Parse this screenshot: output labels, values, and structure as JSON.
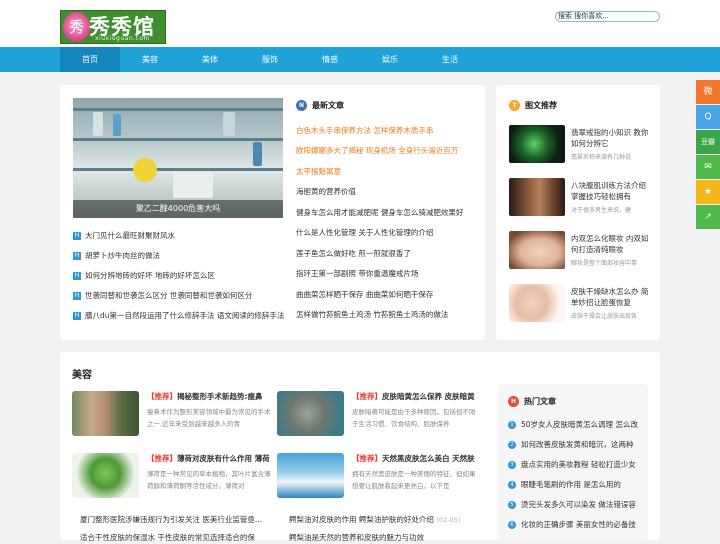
{
  "header": {
    "logo_text": "秀秀馆",
    "logo_glyph": "秀",
    "logo_sub": "xiuxiuguan.com",
    "search_label": "搜索",
    "search_placeholder": "搜索 搜你喜欢..."
  },
  "nav": [
    {
      "label": "首页",
      "active": true
    },
    {
      "label": "美容"
    },
    {
      "label": "美体"
    },
    {
      "label": "服饰"
    },
    {
      "label": "情感"
    },
    {
      "label": "娱乐"
    },
    {
      "label": "生活"
    }
  ],
  "slider": {
    "caption": "聚乙二醇4000危害大吗"
  },
  "featured_list": [
    "大门见什么最旺财聚财风水",
    "胡萝卜炒牛肉丝的做法",
    "如何分辨地砖的好坏 地砖的好坏怎么区",
    "世袭同替和世袭怎么区分 世袭同替和世袭如何区分",
    "膳八du第一自然段运用了什么修辞手法 语文阅读的修辞手法"
  ],
  "latest": {
    "icon": "N",
    "title": "最新文章",
    "items": [
      {
        "text": "白色木头手串保养方法 怎样保养木质手串",
        "hl": true
      },
      {
        "text": "欧阳娜娜多大了揭秘 现身机场 全身行头逼近百万",
        "hl": true
      },
      {
        "text": "太平猴魁寓意",
        "hl": true
      },
      {
        "text": "海胆黄的营养价值",
        "hl": false
      },
      {
        "text": "健身车怎么用才能减肥呢 健身车怎么骑减肥效果好",
        "hl": false
      },
      {
        "text": "什么是人性化管理 关于人性化管理的介绍",
        "hl": false
      },
      {
        "text": "莲子鱼怎么做好吃 煎一煎就很香了",
        "hl": false
      },
      {
        "text": "指环王第一部剧照 带你重温魔戒片场",
        "hl": false
      },
      {
        "text": "曲曲菜怎样晒干保存 曲曲菜如何晒干保存",
        "hl": false
      },
      {
        "text": "怎样做竹荪鲩鱼土鸡汤 竹荪鲩鱼土鸡汤的做法",
        "hl": false
      }
    ]
  },
  "picture_rec": {
    "icon": "T",
    "title": "图文推荐",
    "items": [
      {
        "title": "翡翠戒指的小知识 教你如何分辨它",
        "desc": "翡翠名称来源有几种说"
      },
      {
        "title": "八块腹肌训练方法介绍 掌握技巧轻松拥有",
        "desc": "对于很多男生来说，健"
      },
      {
        "title": "内双怎么化眼妆 内双如何打造清纯眼妆",
        "desc": "眼妆是整个面部妆容中靠"
      },
      {
        "title": "皮肤干燥缺水怎么办 简单妙招让脸蛋恢复",
        "desc": "皮肤干燥会让皮肤出现各"
      }
    ]
  },
  "beauty": {
    "title": "美容",
    "articles": [
      {
        "tag": "【推荐】",
        "title": "揭秘整形手术新趋势:瘦鼻",
        "desc": "瘦鼻术作为整形美容领域中最为常见的手术之一,近年来受到越来越多人的青"
      },
      {
        "tag": "【推荐】",
        "title": "皮肤暗黄怎么保养 皮肤暗黄",
        "desc": "皮肤暗黄可能是由于多种原因，包括但不限于生活习惯、饮食结构、肌肤保养"
      },
      {
        "tag": "【推荐】",
        "title": "薄荷对皮肤有什么作用 薄荷",
        "desc": "薄荷是一种常见的草本植物，其叶片富含薄荷醇和薄荷酮等活性成分。薄荷对"
      },
      {
        "tag": "【推荐】",
        "title": "天然黑皮肤怎么美白 天然肤",
        "desc": "拥有天然黑皮肤是一种美丽的特征，但如果想要让肌肤看起来更亮白，以下是"
      }
    ],
    "bottom": [
      {
        "text": "厦门整形医院涉嫌违规行为引发关注 医美行业监管亟...",
        "date": ""
      },
      {
        "text": "鳄梨油对皮肤的作用 鳄梨油护肤的好处介绍",
        "date": "(02-05)"
      },
      {
        "text": "适合干性皮肤的保湿水 干性皮肤的常见选择适合的保",
        "date": ""
      },
      {
        "text": "鳄梨油是天然的营养和皮肤的魅力与功效",
        "date": ""
      }
    ]
  },
  "hot": {
    "icon": "H",
    "title": "热门文章",
    "items": [
      "50岁女人皮肤暗黄怎么调理 怎么改",
      "如何改善皮肤发黄和暗沉，这两种",
      "盘点实用的美妆教程 轻松打造少女",
      "眼睫毛笔刷的作用 是怎么用的",
      "烫完头发多久可以染发 做法错误容",
      "化妆的正确步骤 美丽女性的必备技"
    ]
  },
  "share_icons": [
    {
      "name": "weibo",
      "glyph": "微",
      "color": "#f4752c"
    },
    {
      "name": "qq",
      "glyph": "Q",
      "color": "#4aa6e8"
    },
    {
      "name": "douban",
      "glyph": "豆瓣",
      "color": "#3aa64a"
    },
    {
      "name": "wechat",
      "glyph": "✉",
      "color": "#4fb94a"
    },
    {
      "name": "favorite",
      "glyph": "★",
      "color": "#f5b619"
    },
    {
      "name": "share",
      "glyph": "↗",
      "color": "#4fb94a"
    }
  ],
  "colors": {
    "nav": "#1ea2d8",
    "accent": "#2d97d8",
    "highlight": "#f07a1a",
    "tag": "#e53935"
  }
}
